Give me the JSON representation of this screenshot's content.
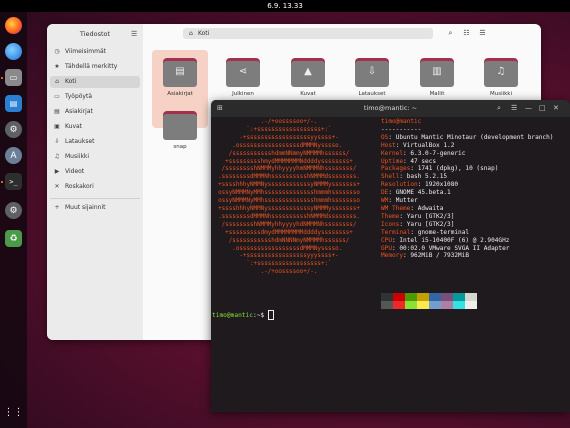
{
  "topbar": {
    "clock": "6.9.  13.33"
  },
  "dock": {
    "icons": [
      "firefox-icon",
      "thunderbird-icon",
      "files-icon",
      "writer-icon",
      "settings-icon",
      "software-icon",
      "terminal-icon",
      "gear-icon",
      "trash-icon",
      "apps-grid-icon"
    ]
  },
  "files": {
    "sidebar_title": "Tiedostot",
    "menu_glyph": "☰",
    "items": [
      {
        "icon": "◷",
        "label": "Viimeisimmät"
      },
      {
        "icon": "★",
        "label": "Tähdellä merkitty"
      },
      {
        "icon": "⌂",
        "label": "Koti"
      },
      {
        "icon": "▭",
        "label": "Työpöytä"
      },
      {
        "icon": "▤",
        "label": "Asiakirjat"
      },
      {
        "icon": "▣",
        "label": "Kuvat"
      },
      {
        "icon": "⇩",
        "label": "Lataukset"
      },
      {
        "icon": "♫",
        "label": "Musiikki"
      },
      {
        "icon": "▶",
        "label": "Videot"
      },
      {
        "icon": "✕",
        "label": "Roskakori"
      }
    ],
    "other_locations": {
      "icon": "+",
      "label": "Muut sijainnit"
    },
    "path": {
      "icon": "⌂",
      "label": "Koti"
    },
    "toolbar": {
      "search": "⌕",
      "list": "☷",
      "view": "☰"
    },
    "folders": [
      {
        "label": "Asiakirjat",
        "glyph": "▤",
        "selected": true
      },
      {
        "label": "Julkinen",
        "glyph": "⋖",
        "selected": false
      },
      {
        "label": "Kuvat",
        "glyph": "▲",
        "selected": false
      },
      {
        "label": "Lataukset",
        "glyph": "⇩",
        "selected": false
      },
      {
        "label": "Mallit",
        "glyph": "▥",
        "selected": false
      },
      {
        "label": "Musiikki",
        "glyph": "♫",
        "selected": false
      },
      {
        "label": "snap",
        "glyph": "",
        "selected": false
      }
    ]
  },
  "terminal": {
    "title": "timo@mantic: ~",
    "newtab": "⊞",
    "header_buttons": [
      "⌕",
      "☰",
      "—",
      "□",
      "✕"
    ],
    "ascii": [
      "              .-/+oossssoo+/-.",
      "          `:+ssssssssssssssssss+:`",
      "        -+ssssssssssssssssssyyssss+-",
      "      .osssssssssssssssssdMMMNysssso.",
      "     /ssssssssssshdmmNNmmyNMMMMhssssss/",
      "    +ssssssssshmydMMMMMMMNddddyssssssss+",
      "   /sssssssshNMMMyhhyyyyhmNMMMNhssssssss/",
      "  .ssssssssdMMMNhsssssssssshNMMMdssssssss.",
      "  +sssshhhyNMMNyssssssssssssyNMMMysssssss+",
      "  ossyNMMMNyMMhsssssssssssssshmmmhssssssso",
      "  ossyNMMMNyMMhsssssssssssssshmmmhssssssso",
      "  +sssshhhyNMMNyssssssssssssyNMMMysssssss+",
      "  .ssssssssdMMMNhsssssssssshNMMMdssssssss.",
      "   /sssssssshNMMMyhhyyyyhdNMMMNhssssssss/",
      "    +sssssssssdmydMMMMMMMMddddyssssssss+",
      "     /ssssssssssshdmNNNNmyNMMMMhssssss/",
      "      .osssssssssssssssssdMMMNysssso.",
      "        -+sssssssssssssssssyyyssss+-",
      "          `:+ssssssssssssssssss+:`",
      "              .-/+oossssoo+/-."
    ],
    "info_user": "timo@mantic",
    "info_sep": "-----------",
    "info": [
      {
        "key": "OS",
        "value": "Ubuntu Mantic Minotaur (development branch)"
      },
      {
        "key": "Host",
        "value": "VirtualBox 1.2"
      },
      {
        "key": "Kernel",
        "value": "6.3.0-7-generic"
      },
      {
        "key": "Uptime",
        "value": "47 secs"
      },
      {
        "key": "Packages",
        "value": "1741 (dpkg), 10 (snap)"
      },
      {
        "key": "Shell",
        "value": "bash 5.2.15"
      },
      {
        "key": "Resolution",
        "value": "1920x1080"
      },
      {
        "key": "DE",
        "value": "GNOME 45.beta.1"
      },
      {
        "key": "WM",
        "value": "Mutter"
      },
      {
        "key": "WM Theme",
        "value": "Adwaita"
      },
      {
        "key": "Theme",
        "value": "Yaru [GTK2/3]"
      },
      {
        "key": "Icons",
        "value": "Yaru [GTK2/3]"
      },
      {
        "key": "Terminal",
        "value": "gnome-terminal"
      },
      {
        "key": "CPU",
        "value": "Intel i5-10400F (6) @ 2.904GHz"
      },
      {
        "key": "GPU",
        "value": "00:02.0 VMware SVGA II Adapter"
      },
      {
        "key": "Memory",
        "value": "962MiB / 7932MiB"
      }
    ],
    "palette_top": [
      "#2e3436",
      "#cc0000",
      "#4e9a06",
      "#c4a000",
      "#3465a4",
      "#75507b",
      "#06989a",
      "#d3d7cf"
    ],
    "palette_bottom": [
      "#555753",
      "#ef2929",
      "#8ae234",
      "#fce94f",
      "#729fcf",
      "#ad7fa8",
      "#34e2e2",
      "#eeeeec"
    ],
    "prompt_user": "timo@mantic",
    "prompt_rest": ":~$ "
  }
}
